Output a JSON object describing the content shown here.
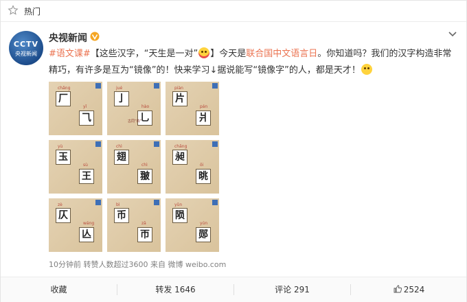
{
  "hot_bar": {
    "label": "热门",
    "icon": "star-icon"
  },
  "author": {
    "name": "央视新闻",
    "avatar_text_top": "CCTV",
    "avatar_text_bottom": "央视新闻",
    "verified": true
  },
  "post": {
    "topic": "#语文课#",
    "part1": "【这些汉字，“天生是一对”",
    "part2": "】今天是",
    "highlight": "联合国中文语言日",
    "part3": "。你知道吗？我们的汉字构造非常精巧，有许多是互为“镜像”的！快来学习↓据说能写“镜像字”的人，都是天才！"
  },
  "images": [
    {
      "top_char": "厂",
      "bottom_char": "⺄",
      "top_pinyin": "chǎng",
      "bottom_pinyin": "yǐ"
    },
    {
      "top_char": "亅",
      "bottom_char": "乚",
      "top_pinyin": "jué",
      "bottom_pinyin": "hào",
      "note": "古同“钩”"
    },
    {
      "top_char": "片",
      "bottom_char": "爿",
      "top_pinyin": "piàn",
      "bottom_pinyin": "pán"
    },
    {
      "top_char": "玉",
      "bottom_char": "王",
      "top_pinyin": "yù",
      "bottom_pinyin": "sù"
    },
    {
      "top_char": "翅",
      "bottom_char": "翍",
      "top_pinyin": "chì",
      "bottom_pinyin": "chì"
    },
    {
      "top_char": "昶",
      "bottom_char": "晀",
      "top_pinyin": "chǎng",
      "bottom_pinyin": "ǒi"
    },
    {
      "top_char": "仄",
      "bottom_char": "亾",
      "top_pinyin": "zè",
      "bottom_pinyin": "wáng"
    },
    {
      "top_char": "币",
      "bottom_char": "帀",
      "top_pinyin": "bì",
      "bottom_pinyin": "zā"
    },
    {
      "top_char": "陨",
      "bottom_char": "郧",
      "top_pinyin": "yǔn",
      "bottom_pinyin": "yún"
    }
  ],
  "meta": "10分钟前  转赞人数超过3600  来自 微博 weibo.com",
  "actions": {
    "favorite": "收藏",
    "repost": "转发 1646",
    "comment": "评论 291",
    "like": "2524"
  },
  "colors": {
    "link": "#eb7350",
    "verified": "#f5a623",
    "badge": "#3e6fb6"
  }
}
